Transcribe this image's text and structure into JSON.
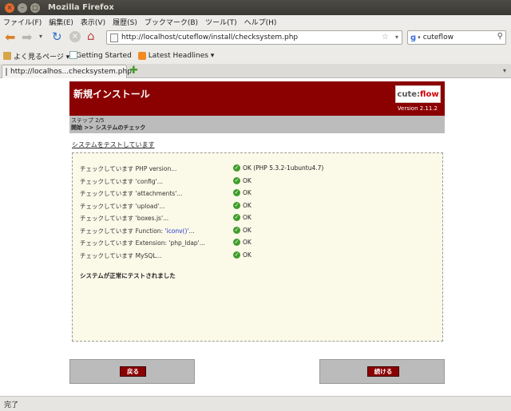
{
  "window": {
    "title": "Mozilla Firefox"
  },
  "menu": [
    "ファイル(F)",
    "編集(E)",
    "表示(V)",
    "履歴(S)",
    "ブックマーク(B)",
    "ツール(T)",
    "ヘルプ(H)"
  ],
  "nav": {
    "url": "http://localhost/cuteflow/install/checksystem.php",
    "search_value": "cuteflow"
  },
  "bookmarks": [
    "よく見るページ ▾",
    "Getting Started",
    "Latest Headlines ▾"
  ],
  "tab": {
    "label": "http://localhos...checksystem.php"
  },
  "page": {
    "title": "新規インストール",
    "logo_text_a": "cute",
    "logo_text_b": "flow",
    "version": "Version 2.11.2",
    "step": "ステップ 2/5",
    "crumb": "開始 >> システムのチェック",
    "section": "システムをテストしています",
    "checks": [
      {
        "label": "チェックしています PHP version...",
        "result": "OK (PHP 5.3.2-1ubuntu4.7)"
      },
      {
        "label": "チェックしています 'config'...",
        "result": "OK"
      },
      {
        "label": "チェックしています 'attachments'...",
        "result": "OK"
      },
      {
        "label": "チェックしています 'upload'...",
        "result": "OK"
      },
      {
        "label": "チェックしています 'boxes.js'...",
        "result": "OK"
      },
      {
        "label_prefix": "チェックしています Function: ",
        "label_hl": "'iconv()'",
        "label_suffix": "...",
        "result": "OK"
      },
      {
        "label": "チェックしています Extension: 'php_ldap'...",
        "result": "OK"
      },
      {
        "label": "チェックしています MySQL...",
        "result": "OK"
      }
    ],
    "success_msg": "システムが正常にテストされました",
    "back_label": "戻る",
    "next_label": "続ける"
  },
  "status": "完了"
}
